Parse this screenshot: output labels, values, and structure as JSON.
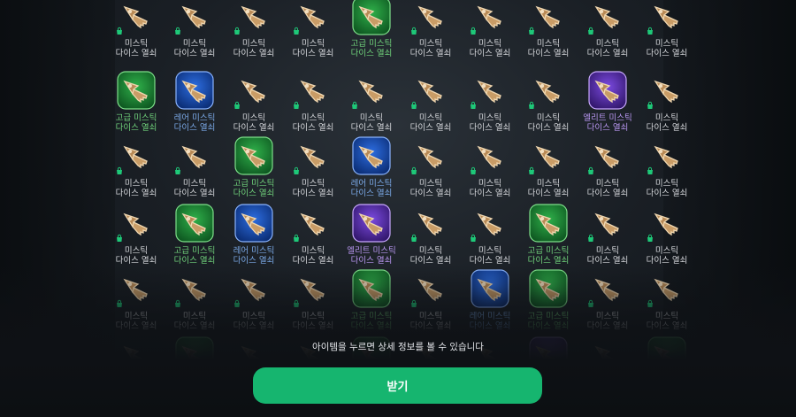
{
  "colors": {
    "accent": "#16b56f",
    "rarity_common": "#d4d6da",
    "rarity_advanced": "#6fd07a",
    "rarity_rare": "#7aa8e6",
    "rarity_elite": "#b896f0"
  },
  "item_icons": {
    "common": "bronze-key-icon",
    "advanced": "green-key-icon",
    "rare": "blue-key-icon",
    "elite": "purple-key-icon",
    "bag": "shopping-bag-icon"
  },
  "names": {
    "common": [
      "미스틱",
      "다이스 열쇠"
    ],
    "advanced": [
      "고급 미스틱",
      "다이스 열쇠"
    ],
    "rare": [
      "레어 미스틱",
      "다이스 열쇠"
    ],
    "elite": [
      "엘리트 미스틱",
      "다이스 열쇠"
    ]
  },
  "grid": {
    "rows": [
      [
        "common",
        "common",
        "common",
        "common",
        "advanced",
        "common",
        "common",
        "common",
        "common",
        "common"
      ],
      [
        "advanced",
        "rare",
        "common",
        "common",
        "common",
        "common",
        "common",
        "common",
        "elite",
        "common"
      ],
      [
        "common",
        "common",
        "advanced",
        "common",
        "rare",
        "common",
        "common",
        "common",
        "common",
        "common"
      ],
      [
        "common",
        "advanced",
        "rare",
        "common",
        "elite",
        "common",
        "common",
        "advanced",
        "common",
        "common"
      ],
      [
        "common",
        "common",
        "common",
        "common",
        "advanced",
        "common",
        "rare",
        "advanced",
        "common",
        "common"
      ],
      [
        "common",
        "advanced",
        "common",
        "common",
        "advanced",
        "common",
        "common",
        "elite",
        "common",
        "advanced"
      ]
    ]
  },
  "hint_text": "아이템을 누르면 상세 정보를 볼 수 있습니다",
  "receive_button": "받기"
}
